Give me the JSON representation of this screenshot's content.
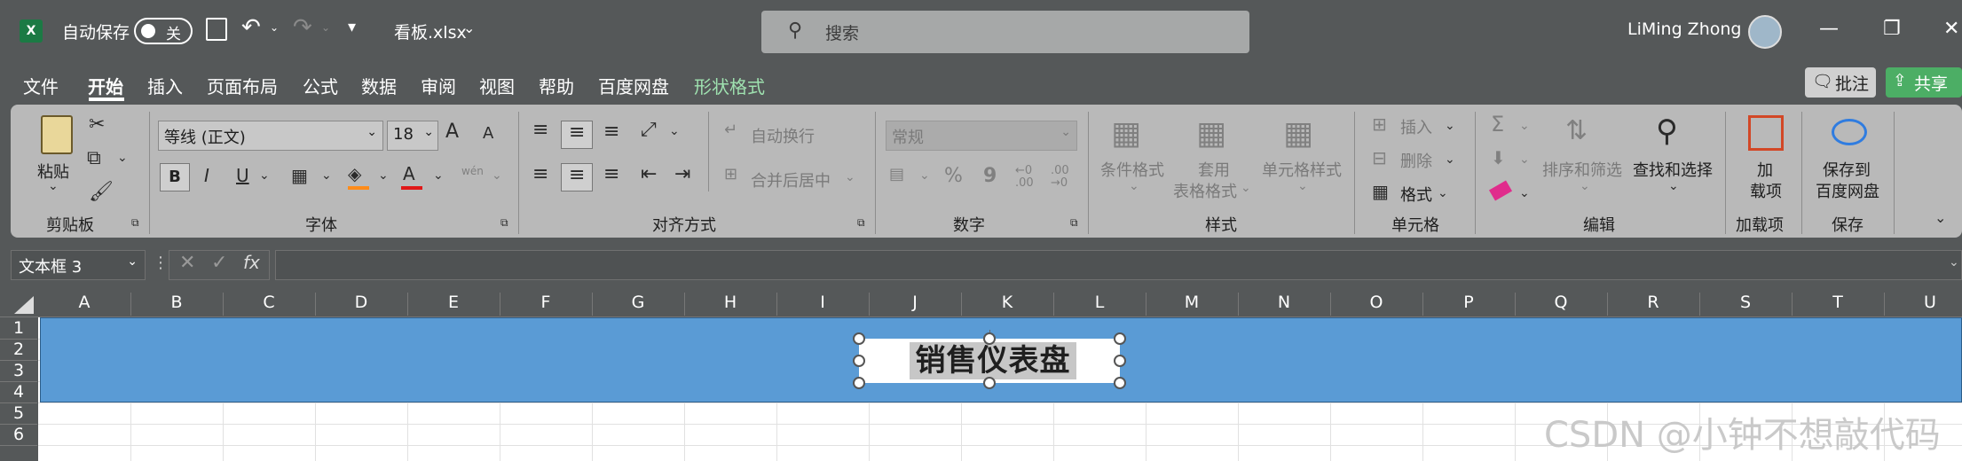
{
  "titlebar": {
    "autosave_label": "自动保存",
    "autosave_state": "关",
    "filename": "看板.xlsx",
    "search_placeholder": "搜索",
    "user_name": "LiMing Zhong"
  },
  "tabs": [
    "文件",
    "开始",
    "插入",
    "页面布局",
    "公式",
    "数据",
    "审阅",
    "视图",
    "帮助",
    "百度网盘",
    "形状格式"
  ],
  "active_tab": "开始",
  "actions": {
    "comment": "批注",
    "share": "共享"
  },
  "ribbon": {
    "clipboard": {
      "paste": "粘贴",
      "group": "剪贴板"
    },
    "font": {
      "name": "等线 (正文)",
      "size": "18",
      "group": "字体",
      "bold": "B",
      "italic": "I",
      "underline": "U",
      "grow": "A",
      "shrink": "A",
      "color_a": "A",
      "wen": "wén"
    },
    "alignment": {
      "wrap": "自动换行",
      "merge": "合并后居中",
      "group": "对齐方式"
    },
    "number": {
      "format": "常规",
      "percent": "%",
      "comma": "9",
      "inc_dec": "←0 .00",
      "dec_dec": ".00 →0",
      "group": "数字"
    },
    "styles": {
      "conditional": "条件格式",
      "table_1": "套用",
      "table_2": "表格格式",
      "cell_styles": "单元格样式",
      "group": "样式"
    },
    "cells": {
      "insert": "插入",
      "delete": "删除",
      "format": "格式",
      "group": "单元格"
    },
    "editing": {
      "sort_filter": "排序和筛选",
      "find_select": "查找和选择",
      "group": "编辑"
    },
    "addins": {
      "label_1": "加",
      "label_2": "载项",
      "group": "加载项"
    },
    "save": {
      "label_1": "保存到",
      "label_2": "百度网盘",
      "group": "保存"
    }
  },
  "formula_bar": {
    "name_box": "文本框 3",
    "fx": "fx",
    "content": ""
  },
  "columns": [
    "A",
    "B",
    "C",
    "D",
    "E",
    "F",
    "G",
    "H",
    "I",
    "J",
    "K",
    "L",
    "M",
    "N",
    "O",
    "P",
    "Q",
    "R",
    "S",
    "T",
    "U"
  ],
  "rows": [
    "1",
    "2",
    "3",
    "4",
    "5",
    "6"
  ],
  "sheet": {
    "textbox_text": "销售仪表盘",
    "band_color": "#5a9bd5"
  },
  "watermark": "CSDN @小钟不想敲代码",
  "colors": {
    "app_bg": "#555859",
    "ribbon_bg": "#b9b9b9",
    "excel_green": "#1b7a44",
    "share_green": "#4cae65"
  }
}
